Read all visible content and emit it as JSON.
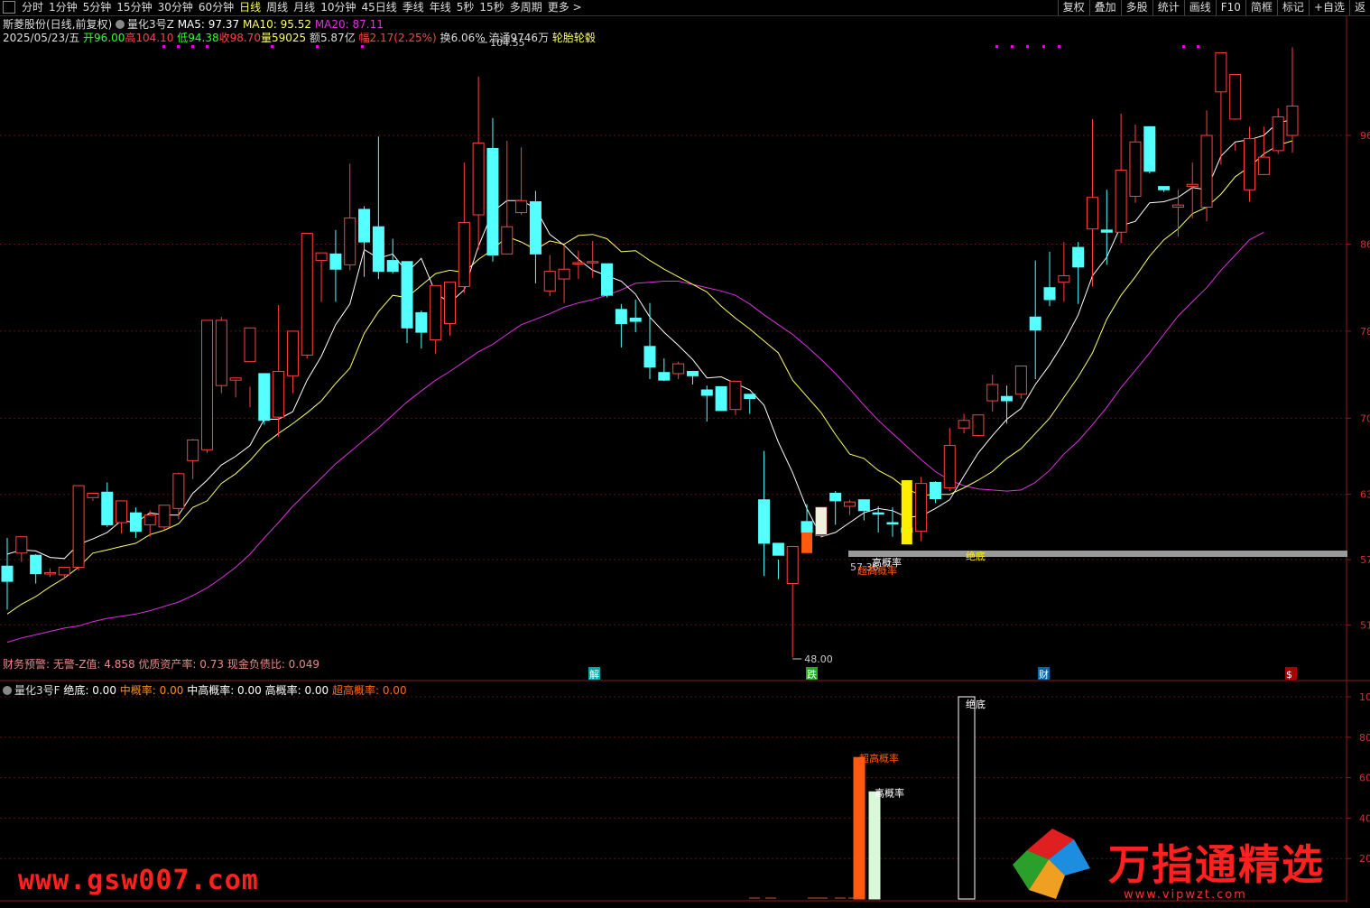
{
  "toolbar": {
    "periods": [
      "分时",
      "1分钟",
      "5分钟",
      "15分钟",
      "30分钟",
      "60分钟",
      "日线",
      "周线",
      "月线",
      "10分钟",
      "45日线",
      "季线",
      "年线",
      "5秒",
      "15秒",
      "多周期",
      "更多 >"
    ],
    "active_period": "日线",
    "right_tools": [
      "复权",
      "叠加",
      "多股",
      "统计",
      "画线",
      "F10",
      "简框",
      "标记",
      "+自选",
      "返"
    ]
  },
  "header": {
    "stock_name": "斯菱股份(日线,前复权)",
    "indicator": "量化3号Z",
    "ma5_label": "MA5: 97.37",
    "ma10_label": "MA10: 95.52",
    "ma20_label": "MA20: 87.11",
    "date": "2025/05/23/五",
    "open": "开96.00",
    "high": "高104.10",
    "low": "低94.38",
    "close": "收98.70",
    "volume": "量59025",
    "amount": "额5.87亿",
    "change": "幅2.17(2.25%)",
    "turnover": "换6.06%",
    "float": "流通9746万",
    "concept": "轮胎轮毂"
  },
  "finance": {
    "text": "财务预警: 无警-Z值: 4.858 优质资产率: 0.73 现金负债比: 0.049"
  },
  "subchart": {
    "name": "量化3号F",
    "items": [
      {
        "label": "绝底: 0.00",
        "color": "#ffffff"
      },
      {
        "label": "中概率: 0.00",
        "color": "#ff8c1a"
      },
      {
        "label": "中高概率: 0.00",
        "color": "#ffffff"
      },
      {
        "label": "高概率: 0.00",
        "color": "#ffffff"
      },
      {
        "label": "超高概率: 0.00",
        "color": "#ff6a1a"
      }
    ]
  },
  "watermarks": {
    "left": "www.gsw007.com",
    "right": "万指通精选",
    "url": "www.vipwzt.com"
  },
  "chart_data": {
    "type": "candlestick",
    "price_axis_ticks": [
      96,
      86,
      78,
      70,
      63,
      57,
      51
    ],
    "sub_axis_ticks": [
      100,
      80,
      60,
      40,
      20
    ],
    "colors": {
      "up": "#ff4040",
      "down": "#54ffff",
      "ma5": "#ffffff",
      "ma10": "#ffff66",
      "ma20": "#dd33dd"
    },
    "candles": [
      [
        56.4,
        59.0,
        55.0,
        52.4
      ],
      [
        57.6,
        58.4,
        59.1,
        56.8
      ],
      [
        57.4,
        57.5,
        55.7,
        54.8
      ],
      [
        55.8,
        56.2,
        55.8,
        55.4
      ],
      [
        55.6,
        56.2,
        56.3,
        55.2
      ],
      [
        56.3,
        63.5,
        63.8,
        56.0
      ],
      [
        62.7,
        62.6,
        63.1,
        62.4
      ],
      [
        63.2,
        64.1,
        60.2,
        60.0
      ],
      [
        60.4,
        61.9,
        62.4,
        59.4
      ],
      [
        61.3,
        61.8,
        59.6,
        59.0
      ],
      [
        60.2,
        61.5,
        61.1,
        59.1
      ],
      [
        60.0,
        62.0,
        62.0,
        59.7
      ],
      [
        61.7,
        65.0,
        64.9,
        60.7
      ],
      [
        66.1,
        68.1,
        68.0,
        64.4
      ],
      [
        67.1,
        73.4,
        79.0,
        66.8
      ],
      [
        73.0,
        79.3,
        79.0,
        72.3
      ],
      [
        73.5,
        73.7,
        73.7,
        71.9
      ],
      [
        75.2,
        72.9,
        78.3,
        71.0
      ],
      [
        74.1,
        74.1,
        69.8,
        69.4
      ],
      [
        70.1,
        80.4,
        74.3,
        68.3
      ],
      [
        73.9,
        77.6,
        78.0,
        72.3
      ],
      [
        75.8,
        87.0,
        87.0,
        75.5
      ],
      [
        84.5,
        85.1,
        85.2,
        80.7
      ],
      [
        85.1,
        87.3,
        83.7,
        80.7
      ],
      [
        84.1,
        93.4,
        88.4,
        83.6
      ],
      [
        89.2,
        89.5,
        86.2,
        83.0
      ],
      [
        87.6,
        95.9,
        83.5,
        82.8
      ],
      [
        84.5,
        86.5,
        83.5,
        83.3
      ],
      [
        84.4,
        84.2,
        78.3,
        76.9
      ],
      [
        79.7,
        79.9,
        77.9,
        76.4
      ],
      [
        77.2,
        82.0,
        82.2,
        75.9
      ],
      [
        78.7,
        82.2,
        82.5,
        77.6
      ],
      [
        82.1,
        93.5,
        88.0,
        81.5
      ],
      [
        88.7,
        101.4,
        95.3,
        85.5
      ],
      [
        94.8,
        97.6,
        85.0,
        84.4
      ],
      [
        85.1,
        95.5,
        87.6,
        85.5
      ],
      [
        88.9,
        94.9,
        90.0,
        88.7
      ],
      [
        89.9,
        90.9,
        85.1,
        82.4
      ],
      [
        81.7,
        85.0,
        83.5,
        81.2
      ],
      [
        82.8,
        85.9,
        83.7,
        80.6
      ],
      [
        84.2,
        85.4,
        84.3,
        82.8
      ],
      [
        84.3,
        86.3,
        84.4,
        82.9
      ],
      [
        84.2,
        84.0,
        81.3,
        81.1
      ],
      [
        80.0,
        80.5,
        78.7,
        76.5
      ],
      [
        79.2,
        80.9,
        78.9,
        77.9
      ],
      [
        76.6,
        80.6,
        74.7,
        73.6
      ],
      [
        74.2,
        75.5,
        73.5,
        73.4
      ],
      [
        74.1,
        75.2,
        75.0,
        73.6
      ],
      [
        74.3,
        74.3,
        73.9,
        73.1
      ],
      [
        72.6,
        73.0,
        72.1,
        69.7
      ],
      [
        72.9,
        72.7,
        70.7,
        70.7
      ],
      [
        70.8,
        73.2,
        73.4,
        70.3
      ],
      [
        72.2,
        72.1,
        71.8,
        70.4
      ],
      [
        62.5,
        67.0,
        58.5,
        55.5
      ],
      [
        58.5,
        57.0,
        57.4,
        55.2
      ],
      [
        54.8,
        58.2,
        58.2,
        48.0
      ],
      [
        60.5,
        62.1,
        59.5,
        59.3
      ],
      [
        59.2,
        61.1,
        61.8,
        59.0
      ],
      [
        63.1,
        63.3,
        62.4,
        60.2
      ],
      [
        61.9,
        62.5,
        62.3,
        61.1
      ],
      [
        62.5,
        62.5,
        61.5,
        60.6
      ],
      [
        61.3,
        61.9,
        61.2,
        59.5
      ],
      [
        60.4,
        61.8,
        60.3,
        59.1
      ],
      [
        59.9,
        60.6,
        59.5,
        58.8
      ],
      [
        59.6,
        64.6,
        64.0,
        58.7
      ],
      [
        64.1,
        64.2,
        62.6,
        62.2
      ],
      [
        63.6,
        69.1,
        67.5,
        63.3
      ],
      [
        69.1,
        70.4,
        69.8,
        68.6
      ],
      [
        68.4,
        69.1,
        70.3,
        68.3
      ],
      [
        71.6,
        74.0,
        73.1,
        70.6
      ],
      [
        72.0,
        73.0,
        71.6,
        69.5
      ],
      [
        72.2,
        74.0,
        74.8,
        71.8
      ],
      [
        79.3,
        84.5,
        78.1,
        73.6
      ],
      [
        82.0,
        85.3,
        80.9,
        80.3
      ],
      [
        82.5,
        86.2,
        83.1,
        80.7
      ],
      [
        85.7,
        86.2,
        83.9,
        80.5
      ],
      [
        87.4,
        97.5,
        90.3,
        82.1
      ],
      [
        87.3,
        91.0,
        87.1,
        84.1
      ],
      [
        87.1,
        98.0,
        92.8,
        86.1
      ],
      [
        90.4,
        97.0,
        95.4,
        89.8
      ],
      [
        96.8,
        95.4,
        92.7,
        92.5
      ],
      [
        91.3,
        91.1,
        91.0,
        90.8
      ],
      [
        89.4,
        91.0,
        89.6,
        86.7
      ],
      [
        91.3,
        93.5,
        91.5,
        88.4
      ],
      [
        89.4,
        98.3,
        96.0,
        88.1
      ],
      [
        100.0,
        100.1,
        103.6,
        93.3
      ],
      [
        97.5,
        95.3,
        101.6,
        94.6
      ],
      [
        91.0,
        96.8,
        95.7,
        89.9
      ],
      [
        92.4,
        96.8,
        94.0,
        92.4
      ],
      [
        94.6,
        98.5,
        97.7,
        94.3
      ],
      [
        96.0,
        104.1,
        98.7,
        94.4
      ]
    ],
    "ma5": [
      57.5,
      57.9,
      57.8,
      57.2,
      57.1,
      58.4,
      58.9,
      59.5,
      60.6,
      60.4,
      61.3,
      61.1,
      61.1,
      63.1,
      64.3,
      65.7,
      66.5,
      67.5,
      69.9,
      69.9,
      70.6,
      73.5,
      75.7,
      78.6,
      80.5,
      85.5,
      84.7,
      85.1,
      83.4,
      84.7,
      81.5,
      80.6,
      81.8,
      85.8,
      89.0,
      90.0,
      90.0,
      89.3,
      86.9,
      85.9,
      84.6,
      83.6,
      83.1,
      82.6,
      81.4,
      79.3,
      77.9,
      76.7,
      75.4,
      73.7,
      73.8,
      73.2,
      72.6,
      71.2,
      67.8,
      65.0,
      61.7,
      59.1,
      59.5,
      60.4,
      61.3,
      61.7,
      61.5,
      60.9,
      61.0,
      61.7,
      62.5,
      64.7,
      66.8,
      68.4,
      69.9,
      70.9,
      73.1,
      74.9,
      77.0,
      79.5,
      83.1,
      84.8,
      87.7,
      88.1,
      89.8,
      89.9,
      90.3,
      91.2,
      91.0,
      94.1,
      95.4,
      95.6,
      96.0,
      97.2,
      97.4
    ],
    "ma10": [
      52.0,
      52.9,
      53.6,
      54.5,
      55.3,
      56.3,
      57.6,
      57.9,
      58.2,
      58.5,
      59.3,
      59.7,
      60.3,
      61.8,
      62.4,
      64.0,
      64.9,
      66.1,
      67.6,
      68.6,
      69.5,
      70.5,
      71.6,
      73.2,
      74.6,
      77.8,
      79.8,
      81.3,
      81.1,
      82.2,
      83.3,
      83.6,
      83.4,
      84.6,
      85.5,
      86.7,
      86.2,
      85.5,
      86.3,
      86.0,
      86.8,
      86.9,
      86.5,
      85.3,
      85.4,
      84.5,
      83.7,
      83.0,
      82.3,
      81.6,
      80.3,
      79.2,
      78.2,
      77.1,
      76.0,
      73.5,
      72.0,
      70.5,
      68.5,
      66.7,
      66.3,
      65.2,
      64.5,
      63.5,
      62.9,
      63.0,
      63.0,
      63.6,
      64.3,
      65.1,
      66.3,
      67.2,
      68.6,
      70.0,
      71.9,
      73.8,
      76.0,
      79.1,
      81.3,
      83.0,
      84.9,
      86.4,
      87.4,
      88.8,
      89.4,
      90.6,
      92.2,
      93.1,
      94.3,
      95.1,
      95.5
    ],
    "ma20": [
      49.4,
      49.8,
      50.1,
      50.4,
      50.7,
      50.9,
      51.3,
      51.6,
      51.8,
      52.0,
      52.3,
      52.7,
      53.1,
      53.7,
      54.4,
      55.3,
      56.3,
      57.5,
      59.0,
      60.4,
      61.9,
      63.2,
      64.5,
      65.8,
      66.9,
      68.0,
      69.1,
      70.3,
      71.5,
      72.5,
      73.5,
      74.3,
      75.2,
      76.1,
      76.8,
      77.7,
      78.6,
      79.1,
      79.6,
      80.2,
      80.6,
      80.9,
      81.3,
      81.8,
      82.4,
      82.5,
      82.6,
      82.6,
      82.3,
      82.0,
      81.7,
      81.3,
      80.5,
      79.5,
      78.6,
      77.7,
      76.6,
      75.4,
      74.1,
      72.7,
      71.2,
      69.8,
      68.6,
      67.4,
      66.2,
      65.1,
      64.3,
      63.8,
      63.5,
      63.4,
      63.3,
      63.4,
      64.1,
      65.2,
      66.7,
      67.9,
      69.4,
      71.0,
      72.8,
      74.4,
      76.0,
      77.7,
      79.4,
      80.7,
      82.0,
      83.6,
      85.0,
      86.4,
      87.1
    ],
    "annotations": {
      "max_label": "104.55",
      "min_label": "48.00",
      "bottom_text": "57.36",
      "gao": "高概率",
      "chaogao": "超高概率",
      "juedi": "绝底",
      "markers": [
        "解",
        "跌",
        "财",
        "$"
      ]
    },
    "sub_bars": [
      {
        "label": "超高概率",
        "value": 70,
        "color": "#ff5a10"
      },
      {
        "label": "高概率",
        "value": 53,
        "color": "#d8f8d8"
      },
      {
        "label": "绝底",
        "value": 100,
        "color": "#000000"
      }
    ]
  }
}
